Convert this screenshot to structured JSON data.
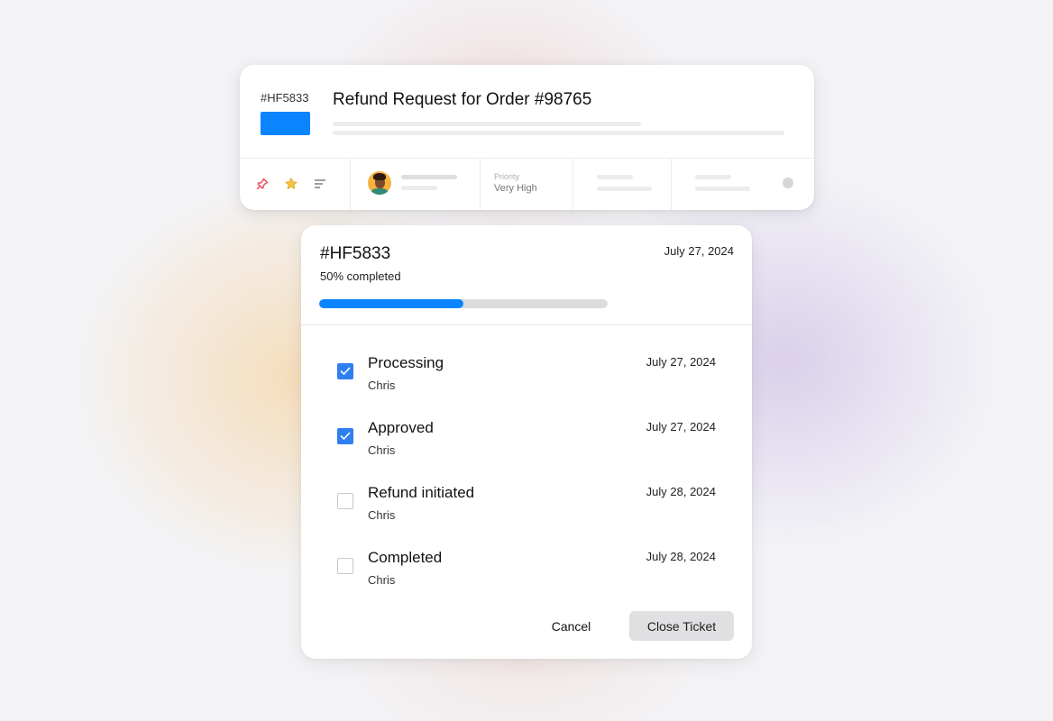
{
  "ticket_card": {
    "id": "#HF5833",
    "title": "Refund Request for Order #98765",
    "priority_label": "Priority",
    "priority_value": "Very High",
    "accent_color": "#0a84ff",
    "icons": [
      "pin-icon",
      "star-icon",
      "menu-lines-icon"
    ]
  },
  "modal": {
    "id": "#HF5833",
    "date": "July 27, 2024",
    "progress_text": "50% completed",
    "progress_fraction": 0.5,
    "steps": [
      {
        "title": "Processing",
        "user": "Chris",
        "date": "July 27, 2024",
        "checked": true
      },
      {
        "title": "Approved",
        "user": "Chris",
        "date": "July 27, 2024",
        "checked": true
      },
      {
        "title": "Refund initiated",
        "user": "Chris",
        "date": "July 28, 2024",
        "checked": false
      },
      {
        "title": "Completed",
        "user": "Chris",
        "date": "July 28, 2024",
        "checked": false
      }
    ],
    "cancel_label": "Cancel",
    "close_label": "Close Ticket"
  }
}
